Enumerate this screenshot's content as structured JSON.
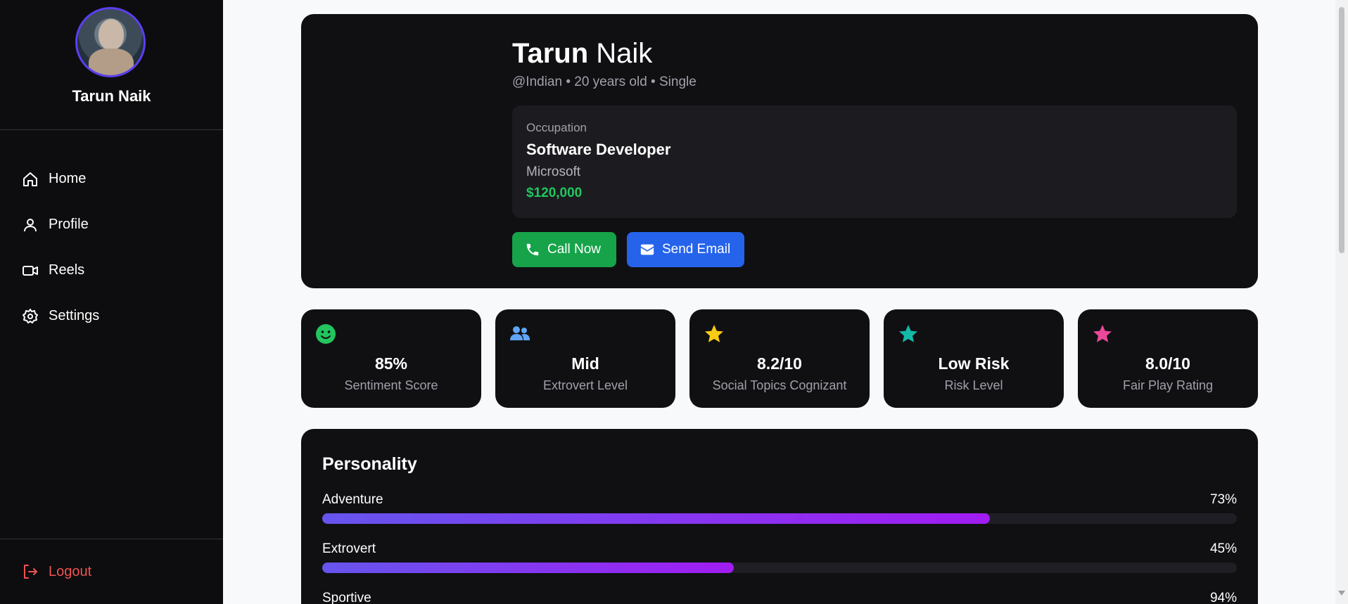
{
  "sidebar": {
    "user_name": "Tarun Naik",
    "nav": [
      {
        "label": "Home",
        "icon": "home-icon"
      },
      {
        "label": "Profile",
        "icon": "user-icon"
      },
      {
        "label": "Reels",
        "icon": "video-icon"
      },
      {
        "label": "Settings",
        "icon": "gear-icon"
      }
    ],
    "logout_label": "Logout"
  },
  "profile": {
    "first_name": "Tarun",
    "last_name": " Naik",
    "subtitle": "@Indian • 20 years old • Single",
    "occupation_label": "Occupation",
    "occupation_title": "Software Developer",
    "company": "Microsoft",
    "salary": "$120,000",
    "call_label": "Call Now",
    "email_label": "Send Email"
  },
  "stats": [
    {
      "value": "85%",
      "label": "Sentiment Score",
      "icon": "smile-icon",
      "color": "#22c55e"
    },
    {
      "value": "Mid",
      "label": "Extrovert Level",
      "icon": "users-icon",
      "color": "#60a5fa"
    },
    {
      "value": "8.2/10",
      "label": "Social Topics Cognizant",
      "icon": "star-icon",
      "color": "#facc15"
    },
    {
      "value": "Low Risk",
      "label": "Risk Level",
      "icon": "star-icon",
      "color": "#14b8a6"
    },
    {
      "value": "8.0/10",
      "label": "Fair Play Rating",
      "icon": "star-icon",
      "color": "#ec4899"
    }
  ],
  "personality": {
    "title": "Personality",
    "traits": [
      {
        "name": "Adventure",
        "percent_label": "73%",
        "value": 73
      },
      {
        "name": "Extrovert",
        "percent_label": "45%",
        "value": 45
      },
      {
        "name": "Sportive",
        "percent_label": "94%",
        "value": 94
      }
    ]
  },
  "colors": {
    "sidebar_bg": "#0d0d0f",
    "card_bg": "#101013",
    "call_button": "#16a34a",
    "email_button": "#2563eb",
    "salary": "#22c55e",
    "logout": "#f05252",
    "avatar_ring": "#5b3ff0"
  }
}
